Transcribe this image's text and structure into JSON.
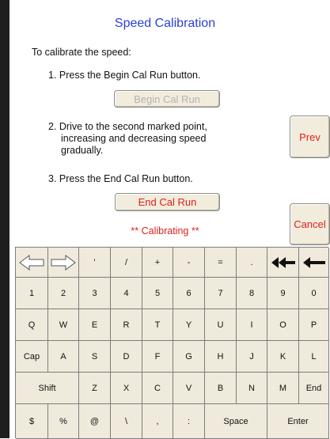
{
  "title": "Speed Calibration",
  "intro": "To calibrate the speed:",
  "steps": [
    "1. Press the Begin Cal Run button.",
    "2. Drive to the second marked point,",
    "increasing and decreasing speed",
    "gradually.",
    "3. Press the End Cal Run button."
  ],
  "buttons": {
    "begin": "Begin Cal Run",
    "end": "End Cal Run",
    "prev": "Prev",
    "cancel": "Cancel"
  },
  "status": "** Calibrating **",
  "keyboard": {
    "row1": [
      "left-arrow-icon",
      "right-arrow-icon",
      "'",
      "/",
      "+",
      "-",
      "=",
      ".",
      "double-backspace-icon",
      "backspace-icon"
    ],
    "row2": [
      "1",
      "2",
      "3",
      "4",
      "5",
      "6",
      "7",
      "8",
      "9",
      "0"
    ],
    "row3": [
      "Q",
      "W",
      "E",
      "R",
      "T",
      "Y",
      "U",
      "I",
      "O",
      "P"
    ],
    "row4": [
      "Cap",
      "A",
      "S",
      "D",
      "F",
      "G",
      "H",
      "J",
      "K",
      "L"
    ],
    "row5": [
      "Shift",
      "Z",
      "X",
      "C",
      "V",
      "B",
      "N",
      "M",
      "End"
    ],
    "row6": [
      "$",
      "%",
      "@",
      "\\",
      ",",
      ":",
      "Space",
      "Enter"
    ]
  },
  "colors": {
    "title": "#2a3fd6",
    "accent_red": "#e0201b",
    "button_face": "#f1ecdc",
    "disabled_text": "#b3b3b3"
  }
}
